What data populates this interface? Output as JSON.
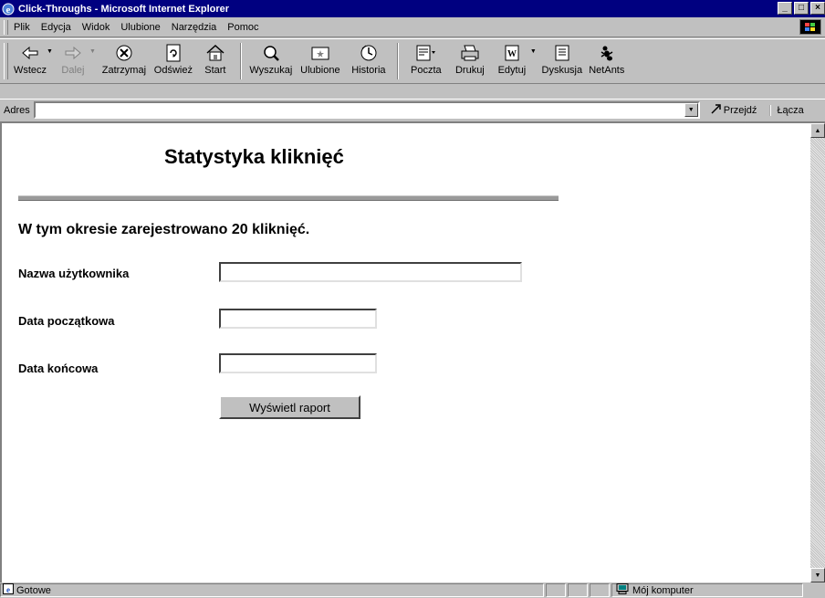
{
  "window": {
    "title": "Click-Throughs - Microsoft Internet Explorer"
  },
  "menu": [
    "Plik",
    "Edycja",
    "Widok",
    "Ulubione",
    "Narzędzia",
    "Pomoc"
  ],
  "toolbar": {
    "back": "Wstecz",
    "forward": "Dalej",
    "stop": "Zatrzymaj",
    "refresh": "Odśwież",
    "home": "Start",
    "search": "Wyszukaj",
    "favorites": "Ulubione",
    "history": "Historia",
    "mail": "Poczta",
    "print": "Drukuj",
    "edit": "Edytuj",
    "discuss": "Dyskusja",
    "netants": "NetAnts"
  },
  "address": {
    "label": "Adres",
    "value": "",
    "go": "Przejdź",
    "links": "Łącza"
  },
  "page": {
    "heading": "Statystyka kliknięć",
    "clicks_text": "W tym okresie zarejestrowano 20 kliknięć.",
    "username_label": "Nazwa użytkownika",
    "username_value": "",
    "start_label": "Data początkowa",
    "start_value": "",
    "end_label": "Data końcowa",
    "end_value": "",
    "report_button": "Wyświetl raport"
  },
  "status": {
    "text": "Gotowe",
    "zone": "Mój komputer"
  }
}
